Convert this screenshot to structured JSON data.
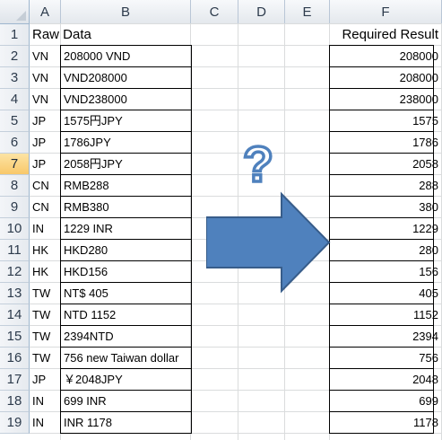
{
  "columns": [
    "A",
    "B",
    "C",
    "D",
    "E",
    "F"
  ],
  "rows": [
    "1",
    "2",
    "3",
    "4",
    "5",
    "6",
    "7",
    "8",
    "9",
    "10",
    "11",
    "12",
    "13",
    "14",
    "15",
    "16",
    "17",
    "18",
    "19"
  ],
  "selected_row": "7",
  "header": {
    "raw_data": "Raw Data",
    "required_result": "Required Result"
  },
  "data_rows": [
    {
      "code": "VN",
      "raw": "208000 VND",
      "result": "208000"
    },
    {
      "code": "VN",
      "raw": "VND208000",
      "result": "208000"
    },
    {
      "code": "VN",
      "raw": "VND238000",
      "result": "238000"
    },
    {
      "code": "JP",
      "raw": "1575円JPY",
      "result": "1575"
    },
    {
      "code": "JP",
      "raw": "1786JPY",
      "result": "1786"
    },
    {
      "code": "JP",
      "raw": "2058円JPY",
      "result": "2058"
    },
    {
      "code": "CN",
      "raw": "RMB288",
      "result": "288"
    },
    {
      "code": "CN",
      "raw": "RMB380",
      "result": "380"
    },
    {
      "code": "IN",
      "raw": "1229 INR",
      "result": "1229"
    },
    {
      "code": "HK",
      "raw": "HKD280",
      "result": "280"
    },
    {
      "code": "HK",
      "raw": "HKD156",
      "result": "156"
    },
    {
      "code": "TW",
      "raw": "NT$ 405",
      "result": "405"
    },
    {
      "code": "TW",
      "raw": "NTD 1152",
      "result": "1152"
    },
    {
      "code": "TW",
      "raw": "2394NTD",
      "result": "2394"
    },
    {
      "code": "TW",
      "raw": "756 new Taiwan dollar",
      "result": "756"
    },
    {
      "code": "JP",
      "raw": "￥2048JPY",
      "result": "2048"
    },
    {
      "code": "IN",
      "raw": "699 INR",
      "result": "699"
    },
    {
      "code": "IN",
      "raw": "INR 1178",
      "result": "1178"
    }
  ],
  "illustration": {
    "question_glyph": "?",
    "question_icon": "question-mark-icon",
    "arrow_icon": "right-arrow-icon",
    "arrow_color": "#4f81bd",
    "arrow_outline": "#385d8a"
  }
}
